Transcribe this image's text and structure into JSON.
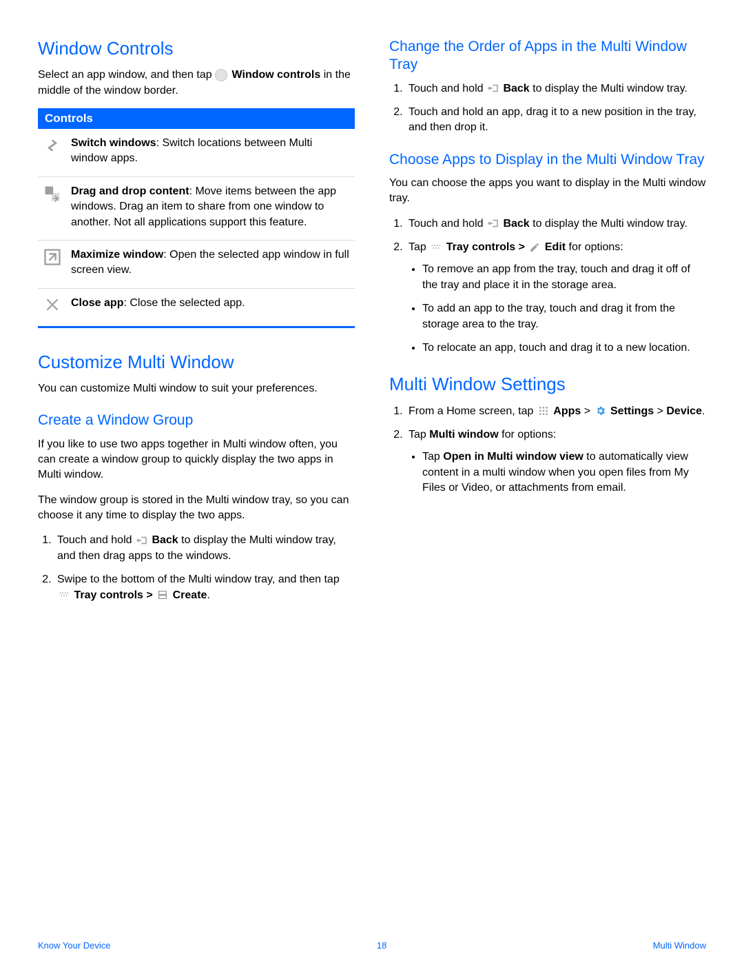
{
  "left": {
    "h_window_controls": "Window Controls",
    "wc_intro_a": "Select an app window, and then tap ",
    "wc_intro_b": "Window controls",
    "wc_intro_c": " in the middle of the window border.",
    "controls_header": "Controls",
    "ctl1_b": "Switch windows",
    "ctl1_t": ": Switch locations between Multi window apps.",
    "ctl2_b": "Drag and drop content",
    "ctl2_t": ": Move items between the app windows. Drag an item to share from one window to another. Not all applications support this feature.",
    "ctl3_b": "Maximize window",
    "ctl3_t": ": Open the selected app window in full screen view.",
    "ctl4_b": "Close app",
    "ctl4_t": ": Close the selected app.",
    "h_customize": "Customize Multi Window",
    "customize_p": "You can customize Multi window to suit your preferences.",
    "h_create_group": "Create a Window Group",
    "cg_p1": "If you like to use two apps together in Multi window often, you can create a window group to quickly display the two apps in Multi window.",
    "cg_p2": "The window group is stored in the Multi window tray, so you can choose it any time to display the two apps.",
    "cg_li1_a": "Touch and hold ",
    "back_label": "Back",
    "cg_li1_c": " to display the Multi window tray, and then drag apps to the windows.",
    "cg_li2_a": "Swipe to the bottom of the Multi window tray, and then tap ",
    "tray_controls_label": "Tray controls >",
    "create_label": "Create",
    "cg_li2_d": "."
  },
  "right": {
    "h_change_order": "Change the Order of Apps in the Multi Window Tray",
    "co_li1_a": "Touch and hold ",
    "co_li1_c": " to display the Multi window tray.",
    "co_li2": "Touch and hold an app, drag it to a new position in the tray, and then drop it.",
    "h_choose_apps": "Choose Apps to Display in the Multi Window Tray",
    "ca_p": "You can choose the apps you want to display in the Multi window tray.",
    "ca_li1_a": "Touch and hold ",
    "ca_li1_c": " to display the Multi window tray.",
    "ca_li2_a": "Tap ",
    "edit_label": "Edit",
    "ca_li2_d": " for options:",
    "ca_b1": "To remove an app from the tray, touch and drag it off of the tray and place it in the storage area.",
    "ca_b2": "To add an app to the tray, touch and drag it from the storage area to the tray.",
    "ca_b3": "To relocate an app, touch and drag it to a new location.",
    "h_settings": "Multi Window Settings",
    "mw_li1_a": "From a Home screen, tap ",
    "apps_label": "Apps",
    "mw_li1_c": " > ",
    "settings_label": "Settings",
    "mw_li1_e": " > ",
    "device_label": "Device",
    "mw_li1_g": ".",
    "mw_li2_a": "Tap ",
    "mw_li2_b": "Multi window",
    "mw_li2_c": " for options:",
    "mw_b1_a": "Tap ",
    "mw_b1_b": "Open in Multi window view",
    "mw_b1_c": " to automatically view content in a multi window when you open files from My Files or Video, or attachments from email."
  },
  "footer": {
    "left": "Know Your Device",
    "center": "18",
    "right": "Multi Window"
  }
}
